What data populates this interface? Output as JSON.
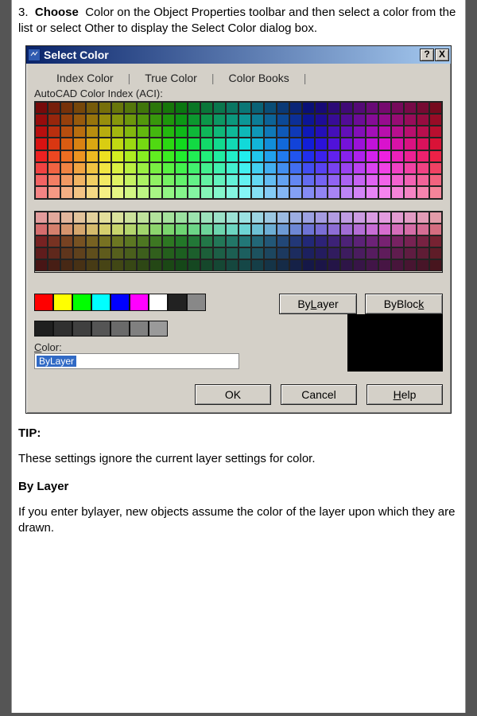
{
  "instruction": {
    "num": "3.",
    "bold1": "Choose",
    "text": "Color on the Object Properties toolbar and then select a color from the list or select Other to display the Select Color dialog box."
  },
  "dialog": {
    "title": "Select Color",
    "help_btn": "?",
    "close_btn": "X",
    "tabs": [
      "Index Color",
      "True Color",
      "Color Books"
    ],
    "subtitle": "AutoCAD Color Index (ACI):",
    "standard_colors": [
      "#ff0000",
      "#ffff00",
      "#00ff00",
      "#00ffff",
      "#0000ff",
      "#ff00ff",
      "#ffffff",
      "#222222",
      "#888888"
    ],
    "gray_colors": [
      "#1f1f1f",
      "#303030",
      "#404040",
      "#555555",
      "#6a6a6a",
      "#808080",
      "#9a9a9a"
    ],
    "bylayer_label": "ByLayer",
    "byblock_label": "ByBlock",
    "color_label": "Color:",
    "color_value": "ByLayer",
    "buttons": {
      "ok": "OK",
      "cancel": "Cancel",
      "help": "Help"
    }
  },
  "tip_label": "TIP:",
  "tip_text": "These settings ignore the current layer settings for color.",
  "bylayer_hdr": "By Layer",
  "bylayer_text": "If you enter bylayer, new objects assume the color of the layer upon which they are drawn."
}
